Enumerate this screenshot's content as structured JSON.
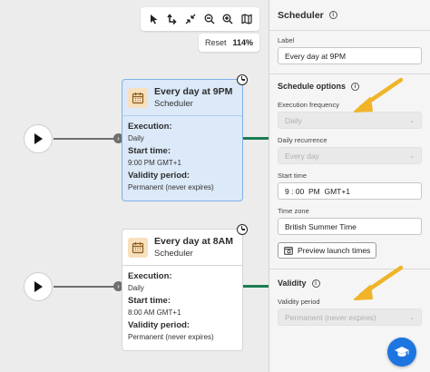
{
  "toolbar": {
    "tools": [
      "pointer-icon",
      "redo-icon",
      "collapse-icon",
      "zoom-out-icon",
      "zoom-in-icon",
      "map-icon"
    ]
  },
  "zoom": {
    "reset_label": "Reset",
    "level": "114%"
  },
  "nodes": [
    {
      "title": "Every day at 9PM",
      "subtitle": "Scheduler",
      "execution_label": "Execution:",
      "execution_value": "Daily",
      "start_label": "Start time:",
      "start_value": "9:00 PM GMT+1",
      "validity_label": "Validity period:",
      "validity_value": "Permanent (never expires)"
    },
    {
      "title": "Every day at 8AM",
      "subtitle": "Scheduler",
      "execution_label": "Execution:",
      "execution_value": "Daily",
      "start_label": "Start time:",
      "start_value": "8:00 AM GMT+1",
      "validity_label": "Validity period:",
      "validity_value": "Permanent (never expires)"
    }
  ],
  "panel": {
    "title": "Scheduler",
    "label_field": {
      "label": "Label",
      "value": "Every day at 9PM"
    },
    "schedule_options": {
      "title": "Schedule options",
      "execution_frequency": {
        "label": "Execution frequency",
        "value": "Daily"
      },
      "daily_recurrence": {
        "label": "Daily recurrence",
        "value": "Every day"
      },
      "start_time": {
        "label": "Start time",
        "value": "9 : 00  PM  GMT+1"
      },
      "time_zone": {
        "label": "Time zone",
        "value": "British Summer Time"
      },
      "preview_button": "Preview launch times"
    },
    "validity": {
      "title": "Validity",
      "validity_period": {
        "label": "Validity period",
        "value": "Permanent (never expires)"
      }
    }
  },
  "colors": {
    "accent": "#1d75e0",
    "selected_bg": "#dbe9f8",
    "link_green": "#1b7d4f",
    "arrow": "#f0b429"
  }
}
